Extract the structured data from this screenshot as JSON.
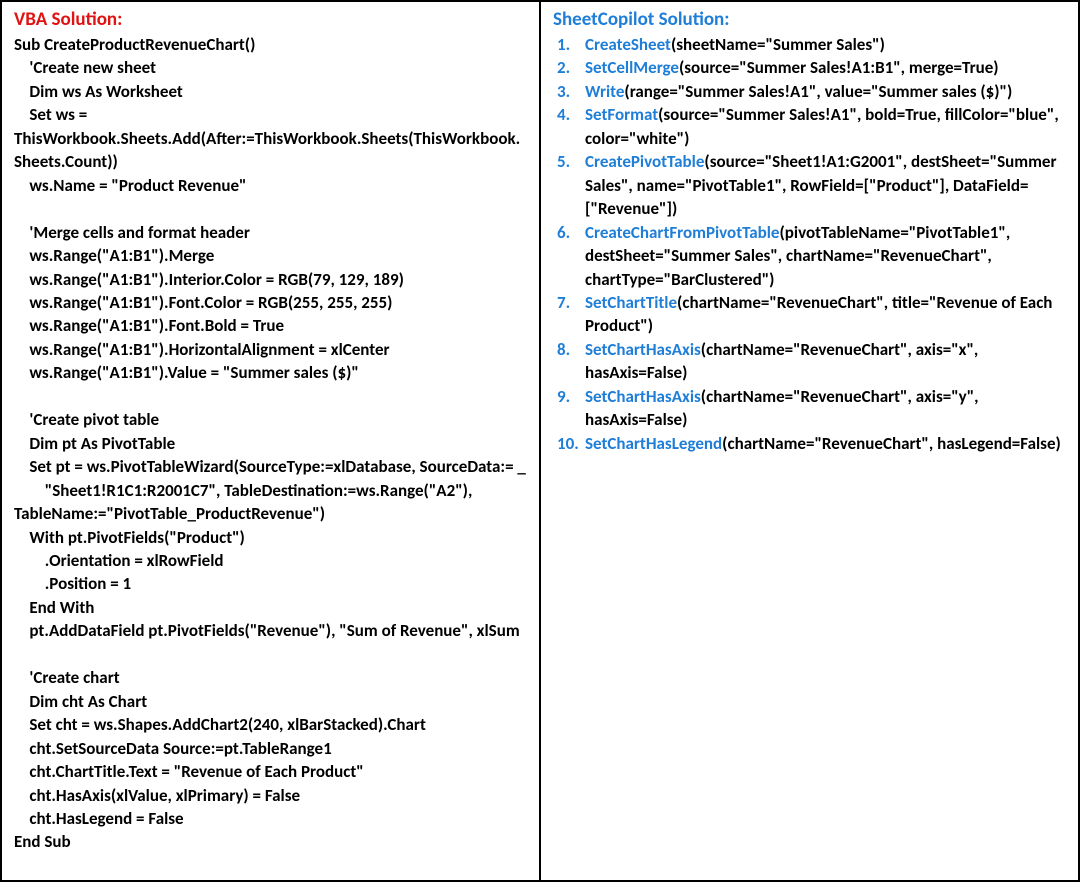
{
  "left": {
    "title": "VBA Solution:",
    "code": "Sub CreateProductRevenueChart()\n    'Create new sheet\n    Dim ws As Worksheet\n    Set ws =\nThisWorkbook.Sheets.Add(After:=ThisWorkbook.Sheets(ThisWorkbook.Sheets.Count))\n    ws.Name = \"Product Revenue\"\n\n    'Merge cells and format header\n    ws.Range(\"A1:B1\").Merge\n    ws.Range(\"A1:B1\").Interior.Color = RGB(79, 129, 189)\n    ws.Range(\"A1:B1\").Font.Color = RGB(255, 255, 255)\n    ws.Range(\"A1:B1\").Font.Bold = True\n    ws.Range(\"A1:B1\").HorizontalAlignment = xlCenter\n    ws.Range(\"A1:B1\").Value = \"Summer sales ($)\"\n\n    'Create pivot table\n    Dim pt As PivotTable\n    Set pt = ws.PivotTableWizard(SourceType:=xlDatabase, SourceData:= _\n        \"Sheet1!R1C1:R2001C7\", TableDestination:=ws.Range(\"A2\"), TableName:=\"PivotTable_ProductRevenue\")\n    With pt.PivotFields(\"Product\")\n        .Orientation = xlRowField\n        .Position = 1\n    End With\n    pt.AddDataField pt.PivotFields(\"Revenue\"), \"Sum of Revenue\", xlSum\n\n    'Create chart\n    Dim cht As Chart\n    Set cht = ws.Shapes.AddChart2(240, xlBarStacked).Chart\n    cht.SetSourceData Source:=pt.TableRange1\n    cht.ChartTitle.Text = \"Revenue of Each Product\"\n    cht.HasAxis(xlValue, xlPrimary) = False\n    cht.HasLegend = False\nEnd Sub"
  },
  "right": {
    "title": "SheetCopilot Solution:",
    "steps": [
      {
        "n": "1.",
        "fn": "CreateSheet",
        "args": "(sheetName=\"Summer Sales\")"
      },
      {
        "n": "2.",
        "fn": "SetCellMerge",
        "args": "(source=\"Summer Sales!A1:B1\", merge=True)"
      },
      {
        "n": "3.",
        "fn": "Write",
        "args": "(range=\"Summer Sales!A1\", value=\"Summer sales ($)\")"
      },
      {
        "n": "4.",
        "fn": "SetFormat",
        "args": "(source=\"Summer Sales!A1\", bold=True, fillColor=\"blue\", color=\"white\")"
      },
      {
        "n": "5.",
        "fn": "CreatePivotTable",
        "args": "(source=\"Sheet1!A1:G2001\", destSheet=\"Summer Sales\", name=\"PivotTable1\", RowField=[\"Product\"], DataField=[\"Revenue\"])"
      },
      {
        "n": "6.",
        "fn": "CreateChartFromPivotTable",
        "args": "(pivotTableName=\"PivotTable1\", destSheet=\"Summer Sales\", chartName=\"RevenueChart\", chartType=\"BarClustered\")"
      },
      {
        "n": "7.",
        "fn": "SetChartTitle",
        "args": "(chartName=\"RevenueChart\", title=\"Revenue of Each Product\")"
      },
      {
        "n": "8.",
        "fn": "SetChartHasAxis",
        "args": "(chartName=\"RevenueChart\", axis=\"x\", hasAxis=False)"
      },
      {
        "n": "9.",
        "fn": "SetChartHasAxis",
        "args": "(chartName=\"RevenueChart\", axis=\"y\", hasAxis=False)"
      },
      {
        "n": "10.",
        "fn": "SetChartHasLegend",
        "args": "(chartName=\"RevenueChart\", hasLegend=False)"
      }
    ]
  }
}
